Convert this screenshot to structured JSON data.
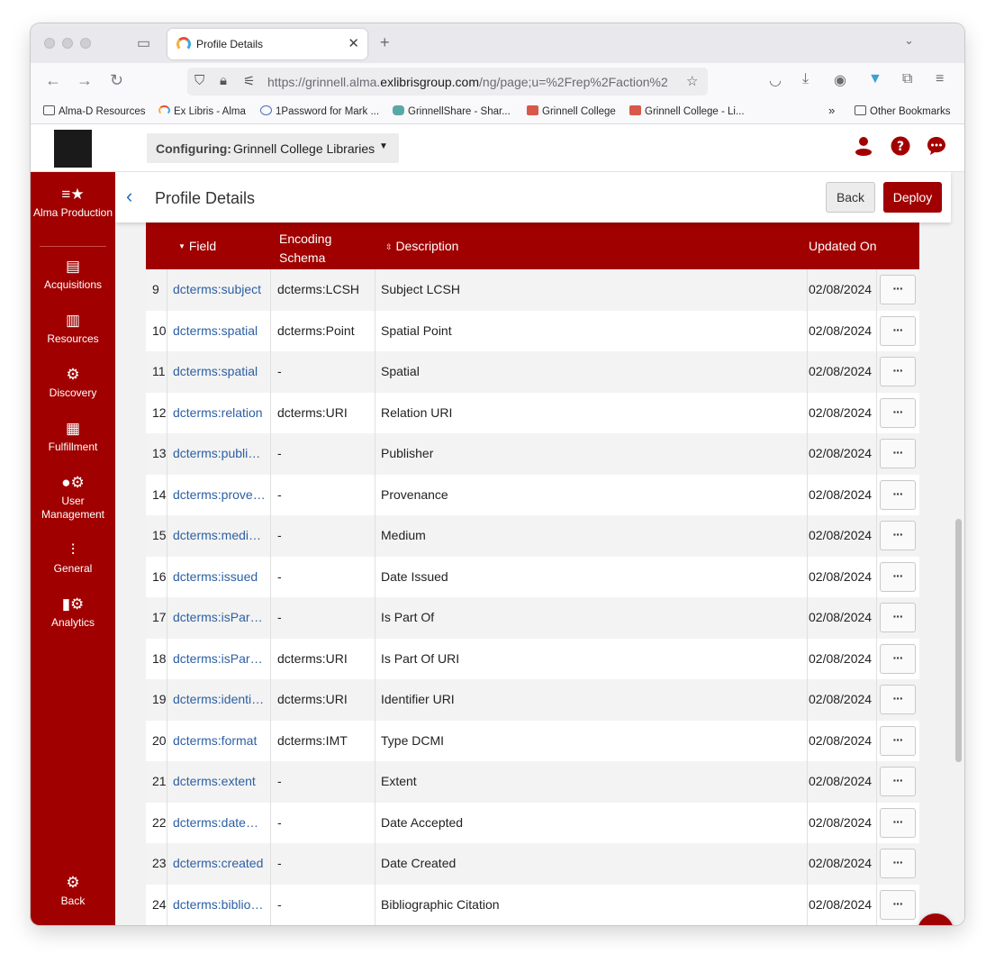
{
  "browser": {
    "tab_title": "Profile Details",
    "tab_close": "✕",
    "new_tab": "+",
    "url_prefix": "https://grinnell.alma.",
    "url_domain": "exlibrisgroup.com",
    "url_suffix": "/ng/page;u=%2Frep%2Faction%2"
  },
  "bookmarks": [
    {
      "label": "Alma-D Resources",
      "icon": "folder-icon"
    },
    {
      "label": "Ex Libris - Alma",
      "icon": "alma-icon"
    },
    {
      "label": "1Password for Mark ...",
      "icon": "onepassword-icon"
    },
    {
      "label": "GrinnellShare - Shar...",
      "icon": "sharepoint-icon"
    },
    {
      "label": "Grinnell College",
      "icon": "book-icon"
    },
    {
      "label": "Grinnell College - Li...",
      "icon": "book-icon"
    }
  ],
  "other_bookmarks": "Other Bookmarks",
  "header": {
    "config_label": "Configuring:",
    "config_value": "Grinnell College Libraries"
  },
  "sidebar": {
    "items": [
      {
        "label": "Alma Production",
        "icon": "alma-production-icon"
      },
      {
        "label": "Acquisitions",
        "icon": "acquisitions-icon"
      },
      {
        "label": "Resources",
        "icon": "resources-icon"
      },
      {
        "label": "Discovery",
        "icon": "discovery-icon"
      },
      {
        "label": "Fulfillment",
        "icon": "fulfillment-icon"
      },
      {
        "label": "User Management",
        "icon": "user-management-icon"
      },
      {
        "label": "General",
        "icon": "general-icon"
      },
      {
        "label": "Analytics",
        "icon": "analytics-icon"
      }
    ],
    "back_label": "Back"
  },
  "page": {
    "title": "Profile Details",
    "back_button": "Back",
    "deploy_button": "Deploy"
  },
  "table": {
    "headers": {
      "field": "Field",
      "encoding_line1": "Encoding",
      "encoding_line2": "Schema",
      "description": "Description",
      "updated_on": "Updated On"
    },
    "rows": [
      {
        "num": "9",
        "field": "dcterms:subject",
        "encoding": "dcterms:LCSH",
        "description": "Subject LCSH",
        "updated": "02/08/2024"
      },
      {
        "num": "10",
        "field": "dcterms:spatial",
        "encoding": "dcterms:Point",
        "description": "Spatial Point",
        "updated": "02/08/2024"
      },
      {
        "num": "11",
        "field": "dcterms:spatial",
        "encoding": "-",
        "description": "Spatial",
        "updated": "02/08/2024"
      },
      {
        "num": "12",
        "field": "dcterms:relation",
        "encoding": "dcterms:URI",
        "description": "Relation URI",
        "updated": "02/08/2024"
      },
      {
        "num": "13",
        "field": "dcterms:publis…",
        "encoding": "-",
        "description": "Publisher",
        "updated": "02/08/2024"
      },
      {
        "num": "14",
        "field": "dcterms:prove…",
        "encoding": "-",
        "description": "Provenance",
        "updated": "02/08/2024"
      },
      {
        "num": "15",
        "field": "dcterms:medi…",
        "encoding": "-",
        "description": "Medium",
        "updated": "02/08/2024"
      },
      {
        "num": "16",
        "field": "dcterms:issued",
        "encoding": "-",
        "description": "Date Issued",
        "updated": "02/08/2024"
      },
      {
        "num": "17",
        "field": "dcterms:isPart…",
        "encoding": "-",
        "description": "Is Part Of",
        "updated": "02/08/2024"
      },
      {
        "num": "18",
        "field": "dcterms:isPart…",
        "encoding": "dcterms:URI",
        "description": "Is Part Of URI",
        "updated": "02/08/2024"
      },
      {
        "num": "19",
        "field": "dcterms:identi…",
        "encoding": "dcterms:URI",
        "description": "Identifier URI",
        "updated": "02/08/2024"
      },
      {
        "num": "20",
        "field": "dcterms:format",
        "encoding": "dcterms:IMT",
        "description": "Type DCMI",
        "updated": "02/08/2024"
      },
      {
        "num": "21",
        "field": "dcterms:extent",
        "encoding": "-",
        "description": "Extent",
        "updated": "02/08/2024"
      },
      {
        "num": "22",
        "field": "dcterms:dateA…",
        "encoding": "-",
        "description": "Date Accepted",
        "updated": "02/08/2024"
      },
      {
        "num": "23",
        "field": "dcterms:created",
        "encoding": "-",
        "description": "Date Created",
        "updated": "02/08/2024"
      },
      {
        "num": "24",
        "field": "dcterms:biblio…",
        "encoding": "-",
        "description": "Bibliographic Citation",
        "updated": "02/08/2024"
      }
    ],
    "row_action": "···"
  },
  "colors": {
    "brand": "#a00000",
    "link": "#2c5fa3",
    "row_alt": "#f3f3f3"
  }
}
